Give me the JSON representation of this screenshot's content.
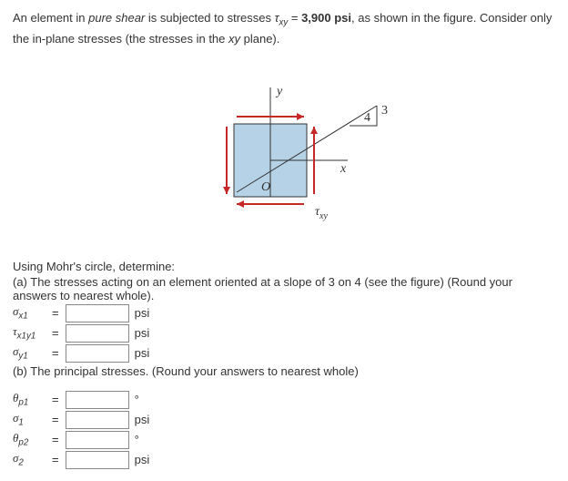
{
  "problem": {
    "intro_part1": "An element in ",
    "intro_em": "pure shear",
    "intro_part2": " is subjected to stresses ",
    "tau_symbol": "τ",
    "tau_sub": "xy",
    "equals": " = ",
    "tau_value": "3,900 psi",
    "intro_part3": ", as shown in the figure. Consider only the in-plane stresses (the stresses in the ",
    "xy_em": "xy",
    "intro_part4": " plane)."
  },
  "figure": {
    "label_y": "y",
    "label_x": "x",
    "label_O": "O",
    "label_3": "3",
    "label_4": "4",
    "label_tau": "τ",
    "label_tau_sub": "xy"
  },
  "prompt": {
    "using": "Using Mohr's circle, determine:",
    "part_a": "(a) The stresses acting on an element oriented at a slope of 3 on 4 (see the figure) (Round your answers to nearest whole).",
    "part_b": "(b) The principal stresses. (Round your answers to nearest whole)"
  },
  "answers": {
    "a": {
      "sigma_x1_label": "σ",
      "sigma_x1_sub": "x1",
      "sigma_x1_value": "",
      "sigma_x1_unit": "psi",
      "tau_x1y1_label": "τ",
      "tau_x1y1_sub": "x1y1",
      "tau_x1y1_value": "",
      "tau_x1y1_unit": "psi",
      "sigma_y1_label": "σ",
      "sigma_y1_sub": "y1",
      "sigma_y1_value": "",
      "sigma_y1_unit": "psi"
    },
    "b": {
      "theta_p1_label": "θ",
      "theta_p1_sub": "p1",
      "theta_p1_value": "",
      "theta_p1_unit": "°",
      "sigma_1_label": "σ",
      "sigma_1_sub": "1",
      "sigma_1_value": "",
      "sigma_1_unit": "psi",
      "theta_p2_label": "θ",
      "theta_p2_sub": "p2",
      "theta_p2_value": "",
      "theta_p2_unit": "°",
      "sigma_2_label": "σ",
      "sigma_2_sub": "2",
      "sigma_2_value": "",
      "sigma_2_unit": "psi"
    }
  },
  "eq_sign": "="
}
